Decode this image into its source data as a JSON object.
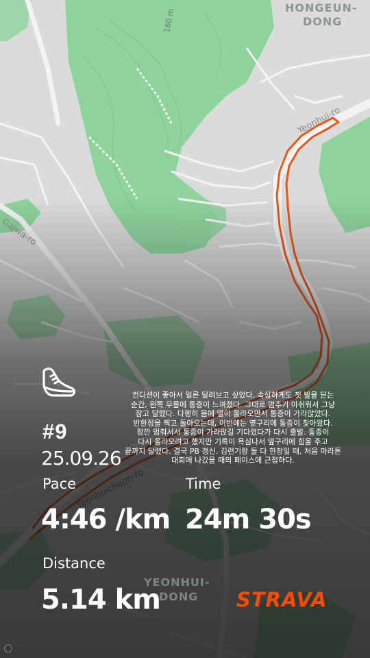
{
  "map": {
    "labels": {
      "district_ne_1": "HONGEUN-",
      "district_ne_2": "DONG",
      "district_s_1": "YEONHUI-",
      "district_s_2": "DONG",
      "road_1": "Yeonhui-ro",
      "road_2": "Gajwa-ro",
      "road_3": "Yeonhuicheon-ro",
      "elevation": "160 m"
    },
    "colors": {
      "base": "#dadcdb",
      "park": "#8ed39c",
      "road": "#f2f3f2",
      "route": "#f25a12"
    }
  },
  "activity": {
    "icon": "running-shoe-icon",
    "number": "#9",
    "date": "25.09.26",
    "note_lines": [
      "컨디션이 좋아서 얼른 달려보고 싶었다. 속상하게도 첫 발을 딛는",
      "순간, 왼쪽 무릎에 통증이 느껴졌다. 그대로 멈추기 아쉬워서 그냥",
      "참고 달렸다. 다행히 몸에 열이 올라오면서 통증이 가라앉았다.",
      "반환점을 찍고 돌아오는데, 이번에는 옆구리에 통증이 찾아왔다.",
      "잠깐 멈춰서서 통증이 가라앉길 기다렸다가 다시 출발. 통증이",
      "다시 올라오려고 했지만 기록이 욕심나서 옆구리에 힘을 주고",
      "끝까지 달렸다. 결국 PB 갱신. 김련기랑 둘 다 한창일 때, 처음 마라톤",
      "대회에 나갔을 때의 페이스에 근접하다."
    ],
    "stats": {
      "pace_label": "Pace",
      "pace_value": "4:46 /km",
      "time_label": "Time",
      "time_value": "24m 30s",
      "distance_label": "Distance",
      "distance_value": "5.14 km"
    }
  },
  "brand": {
    "name": "STRAVA",
    "color": "#fc4c02"
  }
}
